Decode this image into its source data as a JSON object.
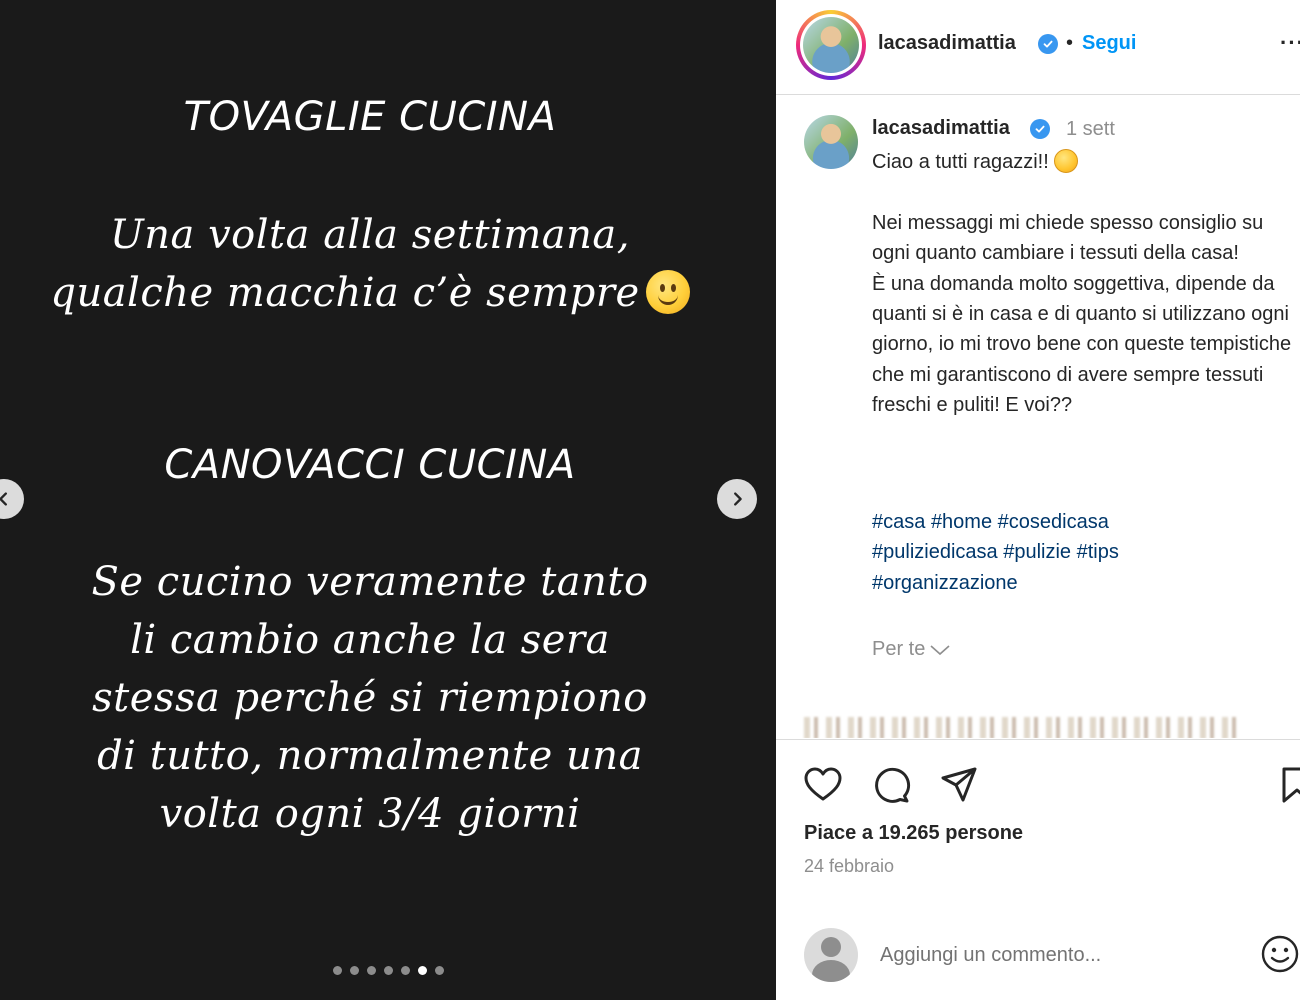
{
  "slide": {
    "heading1": "TOVAGLIE CUCINA",
    "text1": "Una volta alla settimana, qualche macchia c’è sempre",
    "heading2": "CANOVACCI CUCINA",
    "text2": "Se cucino veramente tanto li cambio anche la sera stessa perché si riempiono di tutto, normalmente una volta ogni 3/4 giorni",
    "dots_total": 7,
    "dots_active": 6
  },
  "header": {
    "username": "lacasadimattia",
    "separator": "•",
    "follow_label": "Segui",
    "more_label": "···"
  },
  "post": {
    "username": "lacasadimattia",
    "time": "1 sett",
    "caption_greeting": "Ciao a tutti ragazzi!!",
    "caption_body": "Nei messaggi mi chiede spesso consiglio su ogni quanto cambiare i tessuti della casa!\nÈ una domanda molto soggettiva, dipende da quanti si è in casa e di quanto si utilizzano ogni giorno, io mi trovo bene con queste tempistiche che mi garantiscono di avere sempre tessuti freschi e puliti! E voi??",
    "hashtags": [
      "#casa",
      "#home",
      "#cosedicasa",
      "#puliziedicasa",
      "#pulizie",
      "#tips",
      "#organizzazione"
    ],
    "for_you_label": "Per te"
  },
  "actions": {
    "likes": "Piace a 19.265 persone",
    "date": "24 febbraio",
    "comment_placeholder": "Aggiungi un commento..."
  },
  "colors": {
    "media_bg": "#1a1a1a",
    "link_blue": "#0095f6",
    "hashtag": "#00376b",
    "muted": "#8e8e8e",
    "verified": "#3897f0"
  }
}
